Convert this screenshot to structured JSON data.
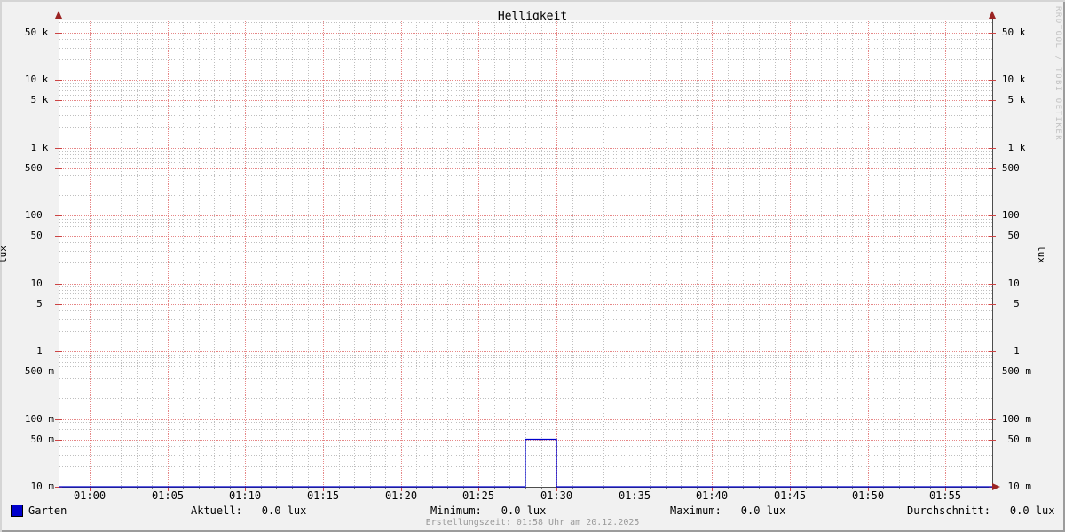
{
  "title": "Helligkeit",
  "watermark": "RRDTOOL / TOBI OETIKER",
  "footer": "Erstellungszeit: 01:58 Uhr am 20.12.2025",
  "legend": {
    "series_label": "Garten",
    "aktuell_label": "Aktuell:",
    "aktuell_value": "0.0 lux",
    "minimum_label": "Minimum:",
    "minimum_value": "0.0 lux",
    "maximum_label": "Maximum:",
    "maximum_value": "0.0 lux",
    "durchschnitt_label": "Durchschnitt:",
    "durchschnitt_value": "0.0 lux"
  },
  "colors": {
    "background": "#f1f1f1",
    "canvas": "#ffffff",
    "shade_top_left": "#d5d5d5",
    "shade_bottom_right": "#9c9c9c",
    "major_grid": "#e06a6a",
    "minor_grid": "#bfbfbf",
    "axis": "#4d4d4d",
    "arrow": "#9b2423",
    "tick": "#cc4444",
    "series": "#0000cc"
  },
  "chart_data": {
    "type": "line",
    "title": "Helligkeit",
    "ylabel": "lux",
    "ylabel_right": "lux",
    "yscale": "log",
    "ylim": [
      0.01,
      70000
    ],
    "grid": true,
    "x_range_clock": [
      "00:58",
      "01:58"
    ],
    "x_range_minutes": [
      58,
      118
    ],
    "x_minor_step_minutes": 1,
    "x_ticks": [
      {
        "label": "01:00",
        "minute": 60
      },
      {
        "label": "01:05",
        "minute": 65
      },
      {
        "label": "01:10",
        "minute": 70
      },
      {
        "label": "01:15",
        "minute": 75
      },
      {
        "label": "01:20",
        "minute": 80
      },
      {
        "label": "01:25",
        "minute": 85
      },
      {
        "label": "01:30",
        "minute": 90
      },
      {
        "label": "01:35",
        "minute": 95
      },
      {
        "label": "01:40",
        "minute": 100
      },
      {
        "label": "01:45",
        "minute": 105
      },
      {
        "label": "01:50",
        "minute": 110
      },
      {
        "label": "01:55",
        "minute": 115
      }
    ],
    "y_ticks": [
      {
        "label": "50 k",
        "value": 50000
      },
      {
        "label": "10 k",
        "value": 10000
      },
      {
        "label": "5 k",
        "value": 5000
      },
      {
        "label": "1 k",
        "value": 1000
      },
      {
        "label": "500",
        "value": 500
      },
      {
        "label": "100",
        "value": 100
      },
      {
        "label": "50",
        "value": 50
      },
      {
        "label": "10",
        "value": 10
      },
      {
        "label": "5",
        "value": 5
      },
      {
        "label": "1",
        "value": 1
      },
      {
        "label": "500 m",
        "value": 0.5
      },
      {
        "label": "100 m",
        "value": 0.1
      },
      {
        "label": "50 m",
        "value": 0.05
      },
      {
        "label": "10 m",
        "value": 0.01
      }
    ],
    "series": [
      {
        "name": "Garten",
        "color": "#0000cc",
        "points": [
          {
            "t_min": 58,
            "lux": 0
          },
          {
            "t_min": 88,
            "lux": 0
          },
          {
            "t_min": 88,
            "lux": 0.05
          },
          {
            "t_min": 90,
            "lux": 0.05
          },
          {
            "t_min": 90,
            "lux": 0
          },
          {
            "t_min": 118,
            "lux": 0
          }
        ]
      }
    ]
  }
}
